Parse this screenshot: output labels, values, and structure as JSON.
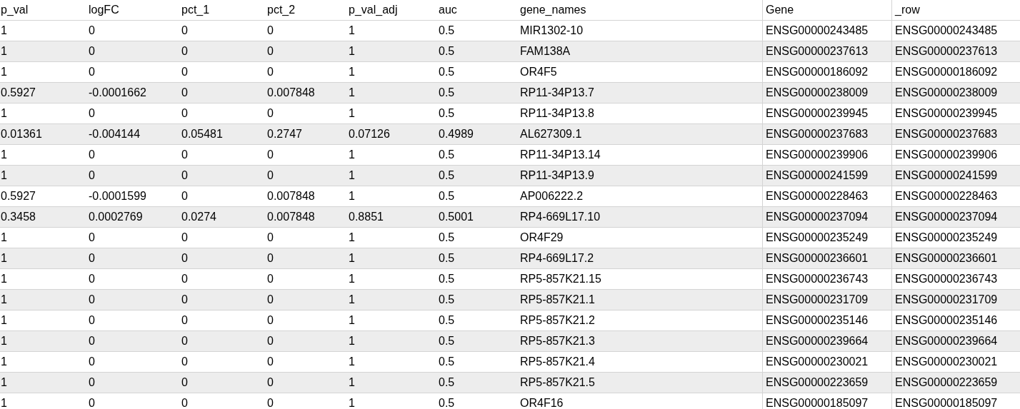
{
  "table": {
    "columns": [
      "p_val",
      "logFC",
      "pct_1",
      "pct_2",
      "p_val_adj",
      "auc",
      "gene_names",
      "Gene",
      "_row"
    ],
    "rows": [
      [
        "1",
        "0",
        "0",
        "0",
        "1",
        "0.5",
        "MIR1302-10",
        "ENSG00000243485",
        "ENSG00000243485"
      ],
      [
        "1",
        "0",
        "0",
        "0",
        "1",
        "0.5",
        "FAM138A",
        "ENSG00000237613",
        "ENSG00000237613"
      ],
      [
        "1",
        "0",
        "0",
        "0",
        "1",
        "0.5",
        "OR4F5",
        "ENSG00000186092",
        "ENSG00000186092"
      ],
      [
        "0.5927",
        "-0.0001662",
        "0",
        "0.007848",
        "1",
        "0.5",
        "RP11-34P13.7",
        "ENSG00000238009",
        "ENSG00000238009"
      ],
      [
        "1",
        "0",
        "0",
        "0",
        "1",
        "0.5",
        "RP11-34P13.8",
        "ENSG00000239945",
        "ENSG00000239945"
      ],
      [
        "0.01361",
        "-0.004144",
        "0.05481",
        "0.2747",
        "0.07126",
        "0.4989",
        "AL627309.1",
        "ENSG00000237683",
        "ENSG00000237683"
      ],
      [
        "1",
        "0",
        "0",
        "0",
        "1",
        "0.5",
        "RP11-34P13.14",
        "ENSG00000239906",
        "ENSG00000239906"
      ],
      [
        "1",
        "0",
        "0",
        "0",
        "1",
        "0.5",
        "RP11-34P13.9",
        "ENSG00000241599",
        "ENSG00000241599"
      ],
      [
        "0.5927",
        "-0.0001599",
        "0",
        "0.007848",
        "1",
        "0.5",
        "AP006222.2",
        "ENSG00000228463",
        "ENSG00000228463"
      ],
      [
        "0.3458",
        "0.0002769",
        "0.0274",
        "0.007848",
        "0.8851",
        "0.5001",
        "RP4-669L17.10",
        "ENSG00000237094",
        "ENSG00000237094"
      ],
      [
        "1",
        "0",
        "0",
        "0",
        "1",
        "0.5",
        "OR4F29",
        "ENSG00000235249",
        "ENSG00000235249"
      ],
      [
        "1",
        "0",
        "0",
        "0",
        "1",
        "0.5",
        "RP4-669L17.2",
        "ENSG00000236601",
        "ENSG00000236601"
      ],
      [
        "1",
        "0",
        "0",
        "0",
        "1",
        "0.5",
        "RP5-857K21.15",
        "ENSG00000236743",
        "ENSG00000236743"
      ],
      [
        "1",
        "0",
        "0",
        "0",
        "1",
        "0.5",
        "RP5-857K21.1",
        "ENSG00000231709",
        "ENSG00000231709"
      ],
      [
        "1",
        "0",
        "0",
        "0",
        "1",
        "0.5",
        "RP5-857K21.2",
        "ENSG00000235146",
        "ENSG00000235146"
      ],
      [
        "1",
        "0",
        "0",
        "0",
        "1",
        "0.5",
        "RP5-857K21.3",
        "ENSG00000239664",
        "ENSG00000239664"
      ],
      [
        "1",
        "0",
        "0",
        "0",
        "1",
        "0.5",
        "RP5-857K21.4",
        "ENSG00000230021",
        "ENSG00000230021"
      ],
      [
        "1",
        "0",
        "0",
        "0",
        "1",
        "0.5",
        "RP5-857K21.5",
        "ENSG00000223659",
        "ENSG00000223659"
      ],
      [
        "1",
        "0",
        "0",
        "0",
        "1",
        "0.5",
        "OR4F16",
        "ENSG00000185097",
        "ENSG00000185097"
      ]
    ]
  }
}
